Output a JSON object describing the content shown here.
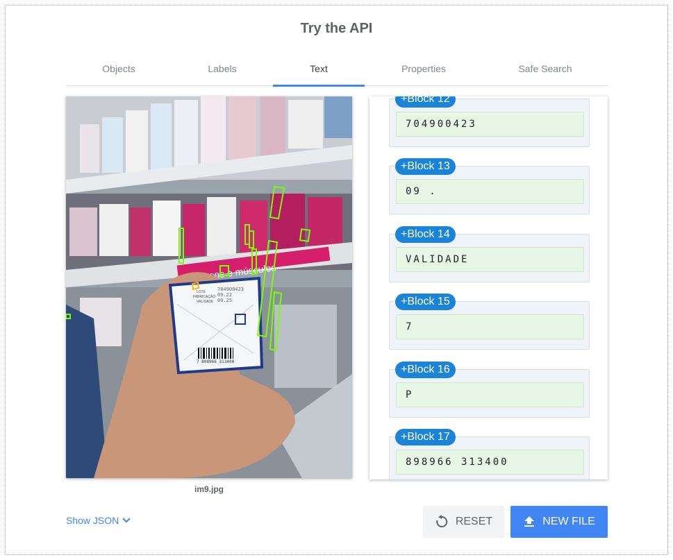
{
  "header": {
    "title": "Try the API"
  },
  "tabs": [
    {
      "label": "Objects"
    },
    {
      "label": "Labels"
    },
    {
      "label": "Text",
      "active": true
    },
    {
      "label": "Properties"
    },
    {
      "label": "Safe Search"
    }
  ],
  "image": {
    "filename": "im9.jpg",
    "package_lines": [
      "LOTE",
      "FABRICAÇÃO",
      "VALIDADE"
    ],
    "package_values": [
      "704900423",
      "09.22",
      "09.25"
    ],
    "barcode_text": "7 898966 313400",
    "shelf_text": "ossos e músculos",
    "detection_color": "#76ff03"
  },
  "blocks": [
    {
      "label": "+Block 12",
      "text": "704900423"
    },
    {
      "label": "+Block 13",
      "text": "09 ."
    },
    {
      "label": "+Block 14",
      "text": "VALIDADE"
    },
    {
      "label": "+Block 15",
      "text": "7"
    },
    {
      "label": "+Block 16",
      "text": "P"
    },
    {
      "label": "+Block 17",
      "text": "898966 313400"
    }
  ],
  "controls": {
    "show_json": "Show JSON",
    "reset": "RESET",
    "new_file": "NEW FILE"
  },
  "colors": {
    "accent": "#4285f4",
    "badge": "#1a84d8"
  }
}
